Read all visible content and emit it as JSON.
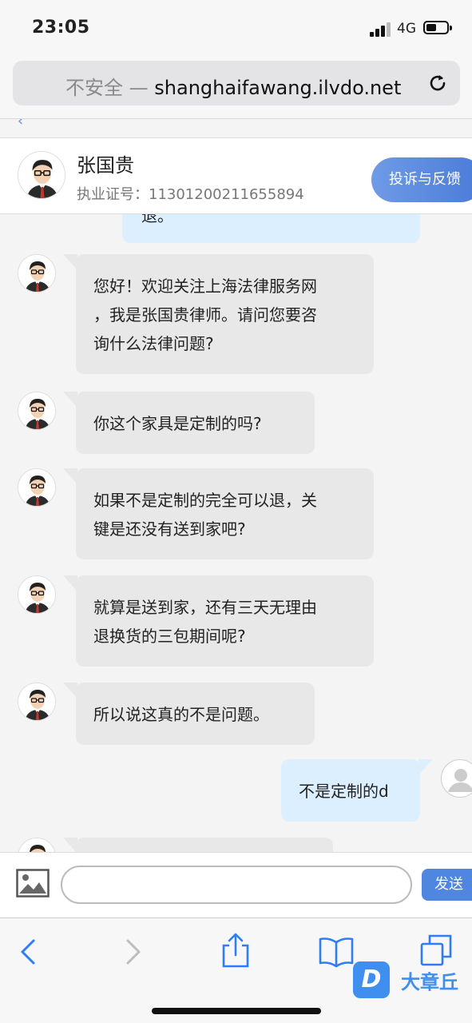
{
  "status": {
    "time": "23:05",
    "network": "4G"
  },
  "browser": {
    "insecure_label": "不安全 —",
    "domain": "shanghaifawang.ilvdo.net"
  },
  "lawyer": {
    "name": "张国贵",
    "license_label": "执业证号：",
    "license_no": "11301200211655894",
    "complain_label": "投诉与反馈"
  },
  "chat": {
    "partial_top": "退。",
    "messages": [
      {
        "from": "lawyer",
        "lines": [
          "您好！欢迎关注上海法律服务网",
          "，我是张国贵律师。请问您要咨",
          "询什么法律问题?"
        ]
      },
      {
        "from": "lawyer",
        "lines": [
          "你这个家具是定制的吗?"
        ]
      },
      {
        "from": "lawyer",
        "lines": [
          "如果不是定制的完全可以退，关",
          "键是还没有送到家吧?"
        ]
      },
      {
        "from": "lawyer",
        "lines": [
          "就算是送到家，还有三天无理由",
          "退换货的三包期间呢?"
        ]
      },
      {
        "from": "lawyer",
        "lines": [
          "所以说这真的不是问题。"
        ]
      },
      {
        "from": "user",
        "lines": [
          "不是定制的d"
        ]
      }
    ]
  },
  "composer": {
    "value": "",
    "send_label": "发送"
  },
  "watermark": {
    "badge": "D",
    "text": "大章丘"
  },
  "colors": {
    "accent": "#4f86df",
    "lawyer_bubble": "#e8e8e8",
    "user_bubble": "#dcefff"
  }
}
